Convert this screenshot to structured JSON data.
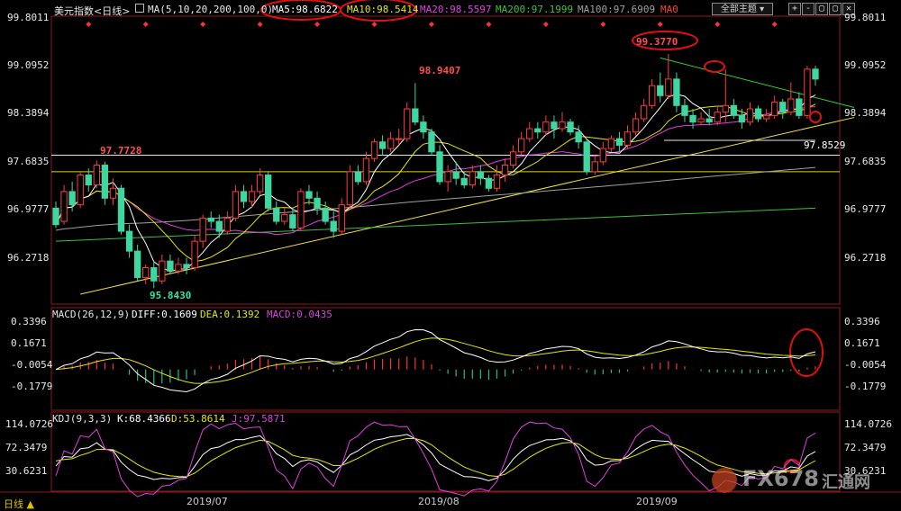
{
  "header": {
    "symbol": "美元指数<日线>",
    "ma_params": "MA(5,10,20,200,100,0)",
    "ma5": "MA5:98.6822",
    "ma10": "MA10:98.5414",
    "ma20": "MA20:98.5597",
    "ma200": "MA200:97.1999",
    "ma100": "MA100:97.6909",
    "ma0": "MA0",
    "theme_button": "全部主题",
    "mini_buttons": [
      "+",
      "-",
      "▢",
      "▢",
      "✕"
    ]
  },
  "macd_header": {
    "params": "MACD(26,12,9)",
    "diff": "DIFF:0.1609",
    "dea": "DEA:0.1392",
    "macd": "MACD:0.0435"
  },
  "kdj_header": {
    "params": "KDJ(9,3,3)",
    "k": "K:68.4366",
    "d": "D:53.8614",
    "j": "J:97.5871"
  },
  "footer": {
    "tab": "日线 ▲",
    "months": [
      "2019/07",
      "2019/08",
      "2019/09"
    ]
  },
  "watermark": {
    "brand": "FX678",
    "cn": "汇通网"
  },
  "colors": {
    "up": "#ff3b3b",
    "down": "#3fd6a0",
    "ma5": "#ffffff",
    "ma10": "#e8e800",
    "ma20": "#e040e0",
    "ma200": "#40c040",
    "ma100": "#a0a0a0",
    "trend_support": "#f0e040",
    "trend_resistance": "#30d030"
  },
  "chart_data": [
    {
      "type": "candlestick",
      "y_ticks": [
        "99.8011",
        "99.0952",
        "98.3894",
        "97.6835",
        "96.9777",
        "96.2718"
      ],
      "ylim": [
        95.6,
        99.95
      ],
      "annotations": {
        "high_jul": "97.7728",
        "low_jul": "95.8430",
        "high_aug": "98.9407",
        "high_sep": "99.3770",
        "support_level": "97.8529"
      },
      "candles": [
        [
          97.05,
          96.8,
          97.15,
          96.75
        ],
        [
          96.85,
          97.3,
          97.4,
          96.8
        ],
        [
          97.3,
          97.1,
          97.45,
          97.0
        ],
        [
          97.1,
          97.55,
          97.6,
          97.05
        ],
        [
          97.55,
          97.4,
          97.65,
          97.3
        ],
        [
          97.4,
          97.7,
          97.77,
          97.35
        ],
        [
          97.7,
          97.2,
          97.75,
          97.1
        ],
        [
          97.2,
          97.35,
          97.5,
          97.1
        ],
        [
          97.35,
          96.7,
          97.4,
          96.65
        ],
        [
          96.7,
          96.4,
          96.8,
          96.3
        ],
        [
          96.4,
          96.0,
          96.5,
          95.95
        ],
        [
          96.0,
          96.15,
          96.2,
          95.9
        ],
        [
          96.15,
          95.95,
          96.25,
          95.84
        ],
        [
          95.95,
          96.25,
          96.35,
          95.9
        ],
        [
          96.25,
          96.1,
          96.35,
          96.05
        ],
        [
          96.1,
          96.2,
          96.3,
          96.05
        ],
        [
          96.2,
          96.15,
          96.3,
          96.05
        ],
        [
          96.15,
          96.55,
          96.65,
          96.1
        ],
        [
          96.55,
          96.9,
          96.95,
          96.45
        ],
        [
          96.9,
          96.85,
          97.0,
          96.75
        ],
        [
          96.85,
          96.7,
          96.95,
          96.6
        ],
        [
          96.7,
          96.9,
          97.0,
          96.65
        ],
        [
          96.9,
          97.3,
          97.4,
          96.85
        ],
        [
          97.3,
          97.15,
          97.4,
          97.05
        ],
        [
          97.15,
          97.3,
          97.4,
          97.05
        ],
        [
          97.3,
          97.55,
          97.65,
          97.25
        ],
        [
          97.55,
          97.05,
          97.6,
          97.0
        ],
        [
          97.05,
          96.85,
          97.15,
          96.8
        ],
        [
          96.85,
          96.95,
          97.05,
          96.8
        ],
        [
          96.95,
          96.75,
          97.05,
          96.7
        ],
        [
          96.75,
          97.3,
          97.35,
          96.7
        ],
        [
          97.3,
          97.2,
          97.4,
          97.1
        ],
        [
          97.2,
          97.05,
          97.3,
          96.95
        ],
        [
          97.05,
          96.85,
          97.15,
          96.8
        ],
        [
          96.85,
          96.7,
          97.0,
          96.6
        ],
        [
          96.7,
          97.1,
          97.2,
          96.65
        ],
        [
          97.1,
          97.6,
          97.7,
          97.05
        ],
        [
          97.6,
          97.45,
          97.7,
          97.4
        ],
        [
          97.45,
          97.8,
          97.9,
          97.4
        ],
        [
          97.8,
          98.05,
          98.1,
          97.75
        ],
        [
          98.05,
          97.95,
          98.15,
          97.85
        ],
        [
          97.95,
          98.1,
          98.2,
          97.9
        ],
        [
          98.1,
          98.1,
          98.25,
          98.0
        ],
        [
          98.1,
          98.55,
          98.65,
          98.05
        ],
        [
          98.55,
          98.35,
          98.94,
          98.3
        ],
        [
          98.35,
          98.2,
          98.45,
          98.1
        ],
        [
          98.2,
          97.9,
          98.25,
          97.85
        ],
        [
          97.9,
          97.45,
          98.0,
          97.4
        ],
        [
          97.45,
          97.6,
          97.7,
          97.3
        ],
        [
          97.6,
          97.5,
          97.75,
          97.4
        ],
        [
          97.5,
          97.4,
          97.6,
          97.35
        ],
        [
          97.4,
          97.6,
          97.7,
          97.35
        ],
        [
          97.6,
          97.5,
          97.7,
          97.4
        ],
        [
          97.5,
          97.35,
          97.55,
          97.3
        ],
        [
          97.35,
          97.55,
          97.7,
          97.3
        ],
        [
          97.55,
          97.7,
          97.8,
          97.45
        ],
        [
          97.7,
          97.9,
          98.0,
          97.65
        ],
        [
          97.9,
          98.1,
          98.2,
          97.85
        ],
        [
          98.1,
          98.25,
          98.35,
          98.05
        ],
        [
          98.25,
          98.2,
          98.35,
          98.1
        ],
        [
          98.2,
          98.35,
          98.45,
          98.15
        ],
        [
          98.35,
          98.25,
          98.45,
          98.1
        ],
        [
          98.25,
          98.35,
          98.5,
          98.2
        ],
        [
          98.35,
          98.2,
          98.4,
          98.15
        ],
        [
          98.2,
          98.05,
          98.3,
          97.95
        ],
        [
          98.05,
          97.6,
          98.1,
          97.55
        ],
        [
          97.6,
          97.75,
          97.85,
          97.55
        ],
        [
          97.75,
          97.95,
          98.05,
          97.7
        ],
        [
          97.95,
          98.1,
          98.15,
          97.9
        ],
        [
          98.1,
          98.0,
          98.2,
          97.9
        ],
        [
          98.0,
          98.2,
          98.3,
          97.95
        ],
        [
          98.2,
          98.4,
          98.5,
          98.15
        ],
        [
          98.4,
          98.6,
          98.7,
          98.35
        ],
        [
          98.6,
          98.9,
          99.0,
          98.55
        ],
        [
          98.9,
          98.75,
          99.1,
          98.65
        ],
        [
          98.75,
          99.0,
          99.38,
          98.7
        ],
        [
          99.0,
          98.6,
          99.1,
          98.5
        ],
        [
          98.6,
          98.45,
          98.7,
          98.35
        ],
        [
          98.45,
          98.35,
          98.55,
          98.25
        ],
        [
          98.35,
          98.4,
          98.5,
          98.3
        ],
        [
          98.4,
          98.35,
          98.55,
          98.3
        ],
        [
          98.35,
          98.5,
          98.6,
          98.3
        ],
        [
          98.5,
          98.6,
          99.15,
          98.35
        ],
        [
          98.6,
          98.45,
          98.7,
          98.4
        ],
        [
          98.45,
          98.35,
          98.55,
          98.25
        ],
        [
          98.35,
          98.55,
          98.65,
          98.3
        ],
        [
          98.55,
          98.4,
          98.6,
          98.35
        ],
        [
          98.4,
          98.45,
          98.55,
          98.35
        ],
        [
          98.45,
          98.65,
          98.75,
          98.4
        ],
        [
          98.65,
          98.5,
          98.7,
          98.4
        ],
        [
          98.5,
          98.7,
          98.95,
          98.45
        ],
        [
          98.7,
          98.45,
          98.8,
          98.4
        ],
        [
          98.45,
          99.15,
          99.2,
          98.4
        ],
        [
          99.15,
          99.0,
          99.2,
          98.9
        ]
      ],
      "lines": {
        "resistance": [
          [
            74,
            99.32
          ],
          [
            95,
            98.62
          ]
        ],
        "support": [
          [
            3,
            95.75
          ],
          [
            95,
            98.4
          ]
        ],
        "horizontal_level": 97.85
      }
    },
    {
      "type": "bar",
      "name": "MACD",
      "y_ticks": [
        "0.3396",
        "0.1671",
        "-0.0054",
        "-0.1779"
      ],
      "ylim": [
        -0.26,
        0.4
      ],
      "x_labels": [
        "2019/07",
        "2019/08",
        "2019/09"
      ]
    },
    {
      "type": "line",
      "name": "KDJ",
      "y_ticks": [
        "114.0726",
        "72.3479",
        "30.6231"
      ],
      "ylim": [
        -5,
        125
      ]
    }
  ]
}
